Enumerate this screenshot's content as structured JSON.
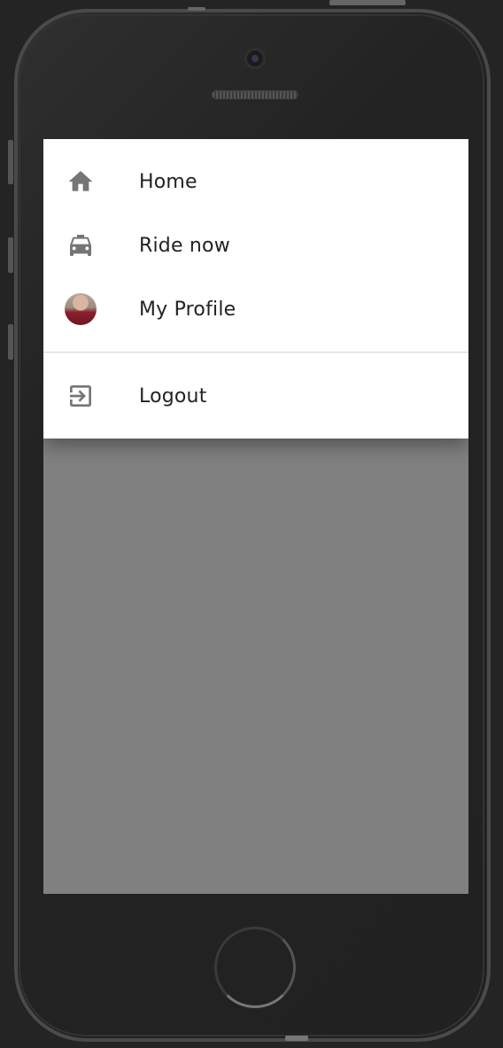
{
  "menu": {
    "items": [
      {
        "label": "Home",
        "icon": "home-icon"
      },
      {
        "label": "Ride now",
        "icon": "taxi-icon"
      },
      {
        "label": "My Profile",
        "icon": "avatar"
      }
    ],
    "logout": {
      "label": "Logout",
      "icon": "logout-icon"
    }
  },
  "colors": {
    "menu_background": "#ffffff",
    "overlay": "#808080",
    "icon": "#757575",
    "text": "#222222",
    "device_frame": "#242424"
  }
}
